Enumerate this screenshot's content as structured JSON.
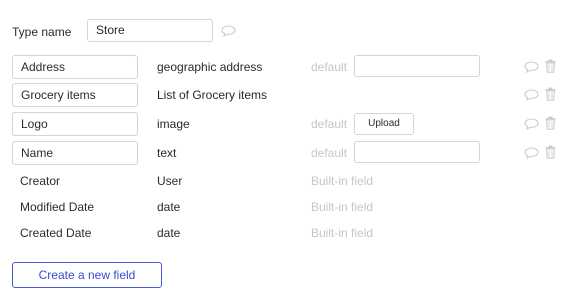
{
  "type_name": {
    "label": "Type name",
    "value": "Store"
  },
  "fields": [
    {
      "name": "Address",
      "type": "geographic address",
      "default_label": "default",
      "default_control": "input",
      "editable": true
    },
    {
      "name": "Grocery items",
      "type": "List of Grocery items",
      "default_label": "",
      "default_control": "none",
      "editable": true
    },
    {
      "name": "Logo",
      "type": "image",
      "default_label": "default",
      "default_control": "upload",
      "upload_label": "Upload",
      "editable": true
    },
    {
      "name": "Name",
      "type": "text",
      "default_label": "default",
      "default_control": "input",
      "editable": true
    },
    {
      "name": "Creator",
      "type": "User",
      "builtin_label": "Built-in field",
      "editable": false
    },
    {
      "name": "Modified Date",
      "type": "date",
      "builtin_label": "Built-in field",
      "editable": false
    },
    {
      "name": "Created Date",
      "type": "date",
      "builtin_label": "Built-in field",
      "editable": false
    }
  ],
  "create_button": {
    "label": "Create a new field"
  },
  "icons": {
    "comment": "comment-icon",
    "delete": "trash-icon"
  },
  "colors": {
    "accent": "#3b4bcf",
    "border": "#d2d4d9",
    "muted": "#c4c6cc",
    "icon": "#c9ccd1"
  }
}
